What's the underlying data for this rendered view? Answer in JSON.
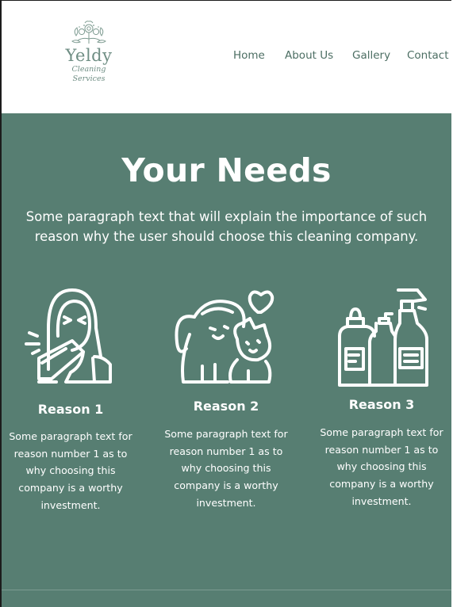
{
  "brand": {
    "name": "Yeldy",
    "tagline": "Cleaning Services",
    "icon": "floral-logo-icon"
  },
  "nav": {
    "items": [
      "Home",
      "About Us",
      "Gallery",
      "Contact"
    ]
  },
  "hero": {
    "title": "Your Needs",
    "paragraph": "Some paragraph text that will explain the importance of such reason why the user should choose this cleaning company."
  },
  "reasons": [
    {
      "title": "Reason 1",
      "icon": "allergy-sneezing-person-icon",
      "text": "Some paragraph text for reason number 1 as to why choosing this company is a worthy investment."
    },
    {
      "title": "Reason 2",
      "icon": "pets-dog-cat-icon",
      "text": "Some paragraph text for reason number 1 as to why choosing this company is a worthy investment."
    },
    {
      "title": "Reason 3",
      "icon": "cleaning-products-icon",
      "text": "Some paragraph text for reason number 1 as to why choosing this company is a worthy investment."
    }
  ],
  "colors": {
    "accent": "#577e72",
    "nav_text": "#4c6e63",
    "logo": "#6f8e84",
    "text_on_accent": "#ffffff"
  }
}
